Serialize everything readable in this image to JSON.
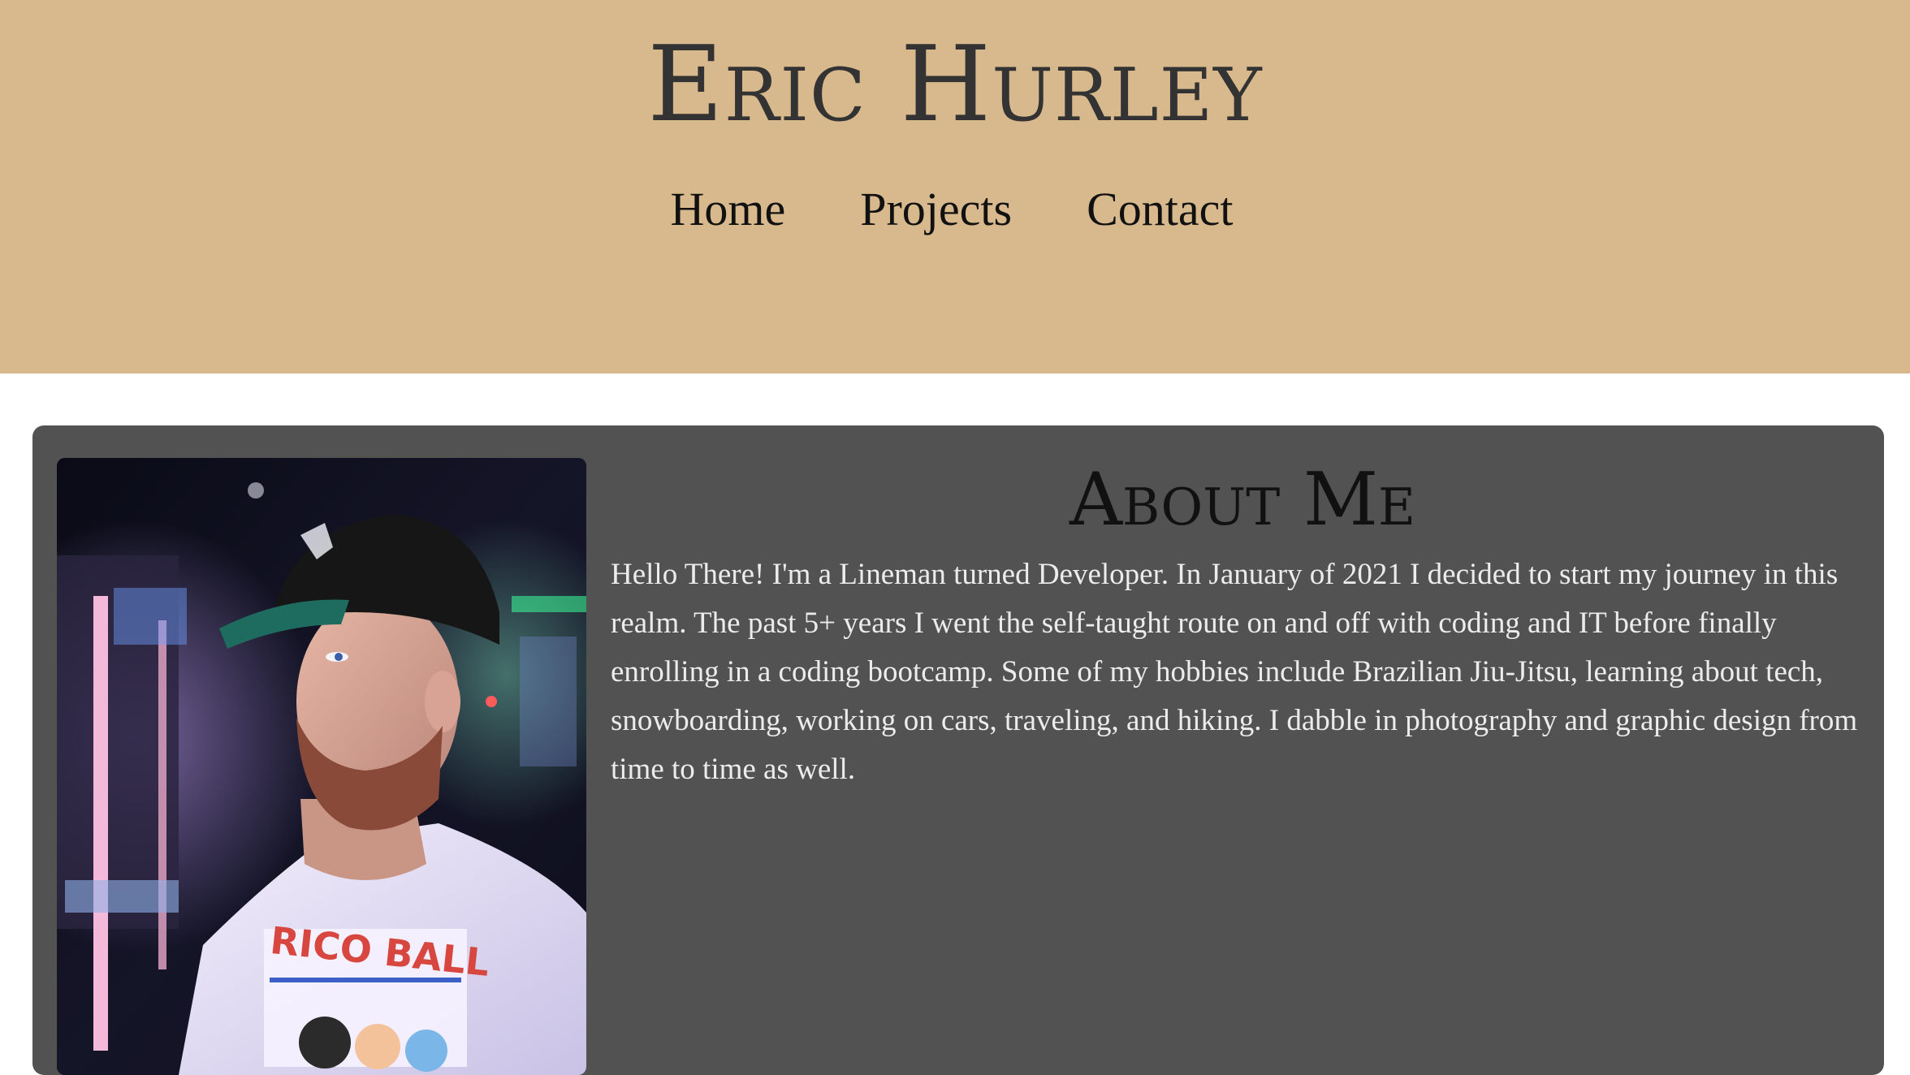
{
  "header": {
    "title": "Eric Hurley",
    "nav": [
      {
        "label": "Home"
      },
      {
        "label": "Projects"
      },
      {
        "label": "Contact"
      }
    ]
  },
  "about": {
    "heading": "About Me",
    "body": "Hello There! I'm a Lineman turned Developer. In January of 2021 I decided to start my journey in this realm. The past 5+ years I went the self-taught route on and off with coding and IT before finally enrolling in a coding bootcamp. Some of my hobbies include Brazilian Jiu-Jitsu, learning about tech, snowboarding, working on cars, traveling, and hiking. I dabble in photography and graphic design from time to time as well.",
    "photo": {
      "shirt_text": "RICO BALL"
    }
  },
  "colors": {
    "header_bg": "#d8b98d",
    "card_bg": "#525252",
    "title_text": "#333333",
    "body_text": "#ececec"
  }
}
